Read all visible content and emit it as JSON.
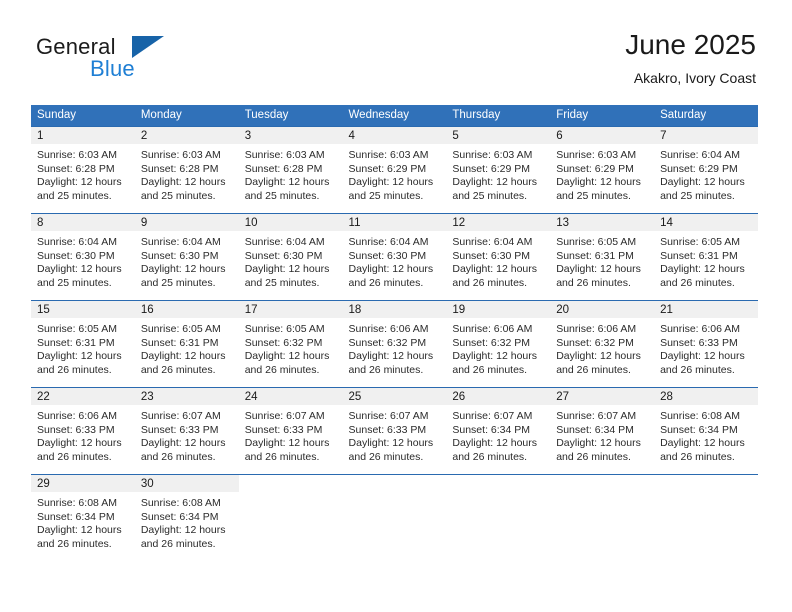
{
  "brand": {
    "name_top": "General",
    "name_bottom": "Blue",
    "accent_color": "#1f7fd4",
    "flag_color": "#1763a8"
  },
  "header": {
    "title": "June 2025",
    "subtitle": "Akakro, Ivory Coast"
  },
  "calendar": {
    "header_bg": "#3071b9",
    "daynum_bg": "#f0f0f0",
    "weekday_headers": [
      "Sunday",
      "Monday",
      "Tuesday",
      "Wednesday",
      "Thursday",
      "Friday",
      "Saturday"
    ],
    "weeks": [
      [
        {
          "day": "1",
          "sunrise": "Sunrise: 6:03 AM",
          "sunset": "Sunset: 6:28 PM",
          "daylight": "Daylight: 12 hours and 25 minutes."
        },
        {
          "day": "2",
          "sunrise": "Sunrise: 6:03 AM",
          "sunset": "Sunset: 6:28 PM",
          "daylight": "Daylight: 12 hours and 25 minutes."
        },
        {
          "day": "3",
          "sunrise": "Sunrise: 6:03 AM",
          "sunset": "Sunset: 6:28 PM",
          "daylight": "Daylight: 12 hours and 25 minutes."
        },
        {
          "day": "4",
          "sunrise": "Sunrise: 6:03 AM",
          "sunset": "Sunset: 6:29 PM",
          "daylight": "Daylight: 12 hours and 25 minutes."
        },
        {
          "day": "5",
          "sunrise": "Sunrise: 6:03 AM",
          "sunset": "Sunset: 6:29 PM",
          "daylight": "Daylight: 12 hours and 25 minutes."
        },
        {
          "day": "6",
          "sunrise": "Sunrise: 6:03 AM",
          "sunset": "Sunset: 6:29 PM",
          "daylight": "Daylight: 12 hours and 25 minutes."
        },
        {
          "day": "7",
          "sunrise": "Sunrise: 6:04 AM",
          "sunset": "Sunset: 6:29 PM",
          "daylight": "Daylight: 12 hours and 25 minutes."
        }
      ],
      [
        {
          "day": "8",
          "sunrise": "Sunrise: 6:04 AM",
          "sunset": "Sunset: 6:30 PM",
          "daylight": "Daylight: 12 hours and 25 minutes."
        },
        {
          "day": "9",
          "sunrise": "Sunrise: 6:04 AM",
          "sunset": "Sunset: 6:30 PM",
          "daylight": "Daylight: 12 hours and 25 minutes."
        },
        {
          "day": "10",
          "sunrise": "Sunrise: 6:04 AM",
          "sunset": "Sunset: 6:30 PM",
          "daylight": "Daylight: 12 hours and 25 minutes."
        },
        {
          "day": "11",
          "sunrise": "Sunrise: 6:04 AM",
          "sunset": "Sunset: 6:30 PM",
          "daylight": "Daylight: 12 hours and 26 minutes."
        },
        {
          "day": "12",
          "sunrise": "Sunrise: 6:04 AM",
          "sunset": "Sunset: 6:30 PM",
          "daylight": "Daylight: 12 hours and 26 minutes."
        },
        {
          "day": "13",
          "sunrise": "Sunrise: 6:05 AM",
          "sunset": "Sunset: 6:31 PM",
          "daylight": "Daylight: 12 hours and 26 minutes."
        },
        {
          "day": "14",
          "sunrise": "Sunrise: 6:05 AM",
          "sunset": "Sunset: 6:31 PM",
          "daylight": "Daylight: 12 hours and 26 minutes."
        }
      ],
      [
        {
          "day": "15",
          "sunrise": "Sunrise: 6:05 AM",
          "sunset": "Sunset: 6:31 PM",
          "daylight": "Daylight: 12 hours and 26 minutes."
        },
        {
          "day": "16",
          "sunrise": "Sunrise: 6:05 AM",
          "sunset": "Sunset: 6:31 PM",
          "daylight": "Daylight: 12 hours and 26 minutes."
        },
        {
          "day": "17",
          "sunrise": "Sunrise: 6:05 AM",
          "sunset": "Sunset: 6:32 PM",
          "daylight": "Daylight: 12 hours and 26 minutes."
        },
        {
          "day": "18",
          "sunrise": "Sunrise: 6:06 AM",
          "sunset": "Sunset: 6:32 PM",
          "daylight": "Daylight: 12 hours and 26 minutes."
        },
        {
          "day": "19",
          "sunrise": "Sunrise: 6:06 AM",
          "sunset": "Sunset: 6:32 PM",
          "daylight": "Daylight: 12 hours and 26 minutes."
        },
        {
          "day": "20",
          "sunrise": "Sunrise: 6:06 AM",
          "sunset": "Sunset: 6:32 PM",
          "daylight": "Daylight: 12 hours and 26 minutes."
        },
        {
          "day": "21",
          "sunrise": "Sunrise: 6:06 AM",
          "sunset": "Sunset: 6:33 PM",
          "daylight": "Daylight: 12 hours and 26 minutes."
        }
      ],
      [
        {
          "day": "22",
          "sunrise": "Sunrise: 6:06 AM",
          "sunset": "Sunset: 6:33 PM",
          "daylight": "Daylight: 12 hours and 26 minutes."
        },
        {
          "day": "23",
          "sunrise": "Sunrise: 6:07 AM",
          "sunset": "Sunset: 6:33 PM",
          "daylight": "Daylight: 12 hours and 26 minutes."
        },
        {
          "day": "24",
          "sunrise": "Sunrise: 6:07 AM",
          "sunset": "Sunset: 6:33 PM",
          "daylight": "Daylight: 12 hours and 26 minutes."
        },
        {
          "day": "25",
          "sunrise": "Sunrise: 6:07 AM",
          "sunset": "Sunset: 6:33 PM",
          "daylight": "Daylight: 12 hours and 26 minutes."
        },
        {
          "day": "26",
          "sunrise": "Sunrise: 6:07 AM",
          "sunset": "Sunset: 6:34 PM",
          "daylight": "Daylight: 12 hours and 26 minutes."
        },
        {
          "day": "27",
          "sunrise": "Sunrise: 6:07 AM",
          "sunset": "Sunset: 6:34 PM",
          "daylight": "Daylight: 12 hours and 26 minutes."
        },
        {
          "day": "28",
          "sunrise": "Sunrise: 6:08 AM",
          "sunset": "Sunset: 6:34 PM",
          "daylight": "Daylight: 12 hours and 26 minutes."
        }
      ],
      [
        {
          "day": "29",
          "sunrise": "Sunrise: 6:08 AM",
          "sunset": "Sunset: 6:34 PM",
          "daylight": "Daylight: 12 hours and 26 minutes."
        },
        {
          "day": "30",
          "sunrise": "Sunrise: 6:08 AM",
          "sunset": "Sunset: 6:34 PM",
          "daylight": "Daylight: 12 hours and 26 minutes."
        },
        {
          "day": "",
          "sunrise": "",
          "sunset": "",
          "daylight": ""
        },
        {
          "day": "",
          "sunrise": "",
          "sunset": "",
          "daylight": ""
        },
        {
          "day": "",
          "sunrise": "",
          "sunset": "",
          "daylight": ""
        },
        {
          "day": "",
          "sunrise": "",
          "sunset": "",
          "daylight": ""
        },
        {
          "day": "",
          "sunrise": "",
          "sunset": "",
          "daylight": ""
        }
      ]
    ]
  }
}
